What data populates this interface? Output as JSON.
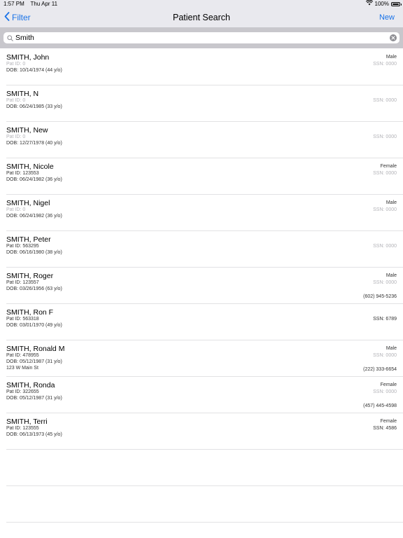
{
  "status": {
    "time": "1:57 PM",
    "date": "Thu Apr 11",
    "battery": "100%",
    "battery_level": 1.0
  },
  "nav": {
    "back_label": "Filter",
    "title": "Patient Search",
    "new_label": "New"
  },
  "search": {
    "value": "Smith",
    "placeholder": ""
  },
  "patients": [
    {
      "name": "SMITH, John",
      "pat_id": "Pat ID: 0",
      "pat_id_muted": true,
      "dob": "DOB: 10/14/1974 (44 y/o)",
      "address": "",
      "gender": "Male",
      "ssn": "SSN: 0000",
      "ssn_muted": true,
      "phone": ""
    },
    {
      "name": "SMITH, N",
      "pat_id": "Pat ID: 0",
      "pat_id_muted": true,
      "dob": "DOB: 06/24/1985 (33 y/o)",
      "address": "",
      "gender": "",
      "ssn": "SSN: 0000",
      "ssn_muted": true,
      "phone": ""
    },
    {
      "name": "SMITH, New",
      "pat_id": "Pat ID: 0",
      "pat_id_muted": true,
      "dob": "DOB: 12/27/1978 (40 y/o)",
      "address": "",
      "gender": "",
      "ssn": "SSN: 0000",
      "ssn_muted": true,
      "phone": ""
    },
    {
      "name": "SMITH, Nicole",
      "pat_id": "Pat ID: 123553",
      "pat_id_muted": false,
      "dob": "DOB: 06/24/1982 (36 y/o)",
      "address": "",
      "gender": "Female",
      "ssn": "SSN: 0000",
      "ssn_muted": true,
      "phone": ""
    },
    {
      "name": "SMITH, Nigel",
      "pat_id": "Pat ID: 0",
      "pat_id_muted": true,
      "dob": "DOB: 06/24/1982 (36 y/o)",
      "address": "",
      "gender": "Male",
      "ssn": "SSN: 0000",
      "ssn_muted": true,
      "phone": ""
    },
    {
      "name": "SMITH, Peter",
      "pat_id": "Pat ID: 563295",
      "pat_id_muted": false,
      "dob": "DOB: 06/16/1980 (38 y/o)",
      "address": "",
      "gender": "",
      "ssn": "SSN: 0000",
      "ssn_muted": true,
      "phone": ""
    },
    {
      "name": "SMITH, Roger",
      "pat_id": "Pat ID: 123557",
      "pat_id_muted": false,
      "dob": "DOB: 03/26/1956 (63 y/o)",
      "address": "",
      "gender": "Male",
      "ssn": "SSN: 0000",
      "ssn_muted": true,
      "phone": "(602) 945-5236"
    },
    {
      "name": "SMITH, Ron F",
      "pat_id": "Pat ID: 563318",
      "pat_id_muted": false,
      "dob": "DOB: 03/01/1970 (49 y/o)",
      "address": "",
      "gender": "",
      "ssn": "SSN: 6789",
      "ssn_muted": false,
      "phone": ""
    },
    {
      "name": "SMITH, Ronald M",
      "pat_id": "Pat ID: 478955",
      "pat_id_muted": false,
      "dob": "DOB: 05/12/1987 (31 y/o)",
      "address": "123 W Main St",
      "gender": "Male",
      "ssn": "SSN: 0000",
      "ssn_muted": true,
      "phone": "(222) 333-6654"
    },
    {
      "name": "SMITH, Ronda",
      "pat_id": "Pat ID: 322655",
      "pat_id_muted": false,
      "dob": "DOB: 05/12/1987 (31 y/o)",
      "address": "",
      "gender": "Female",
      "ssn": "SSN: 0000",
      "ssn_muted": true,
      "phone": "(457) 445-4598"
    },
    {
      "name": "SMITH, Terri",
      "pat_id": "Pat ID: 123555",
      "pat_id_muted": false,
      "dob": "DOB: 06/13/1973 (45 y/o)",
      "address": "",
      "gender": "Female",
      "ssn": "SSN: 4586",
      "ssn_muted": false,
      "phone": ""
    }
  ],
  "colors": {
    "accent": "#1a73e8",
    "muted_text": "#b3b3b8",
    "bar_background": "#e9e9ee",
    "search_background": "#c8c7cc"
  },
  "icons": {
    "back": "chevron-left-icon",
    "search": "search-icon",
    "clear": "clear-icon",
    "wifi": "wifi-icon",
    "battery": "battery-icon"
  }
}
